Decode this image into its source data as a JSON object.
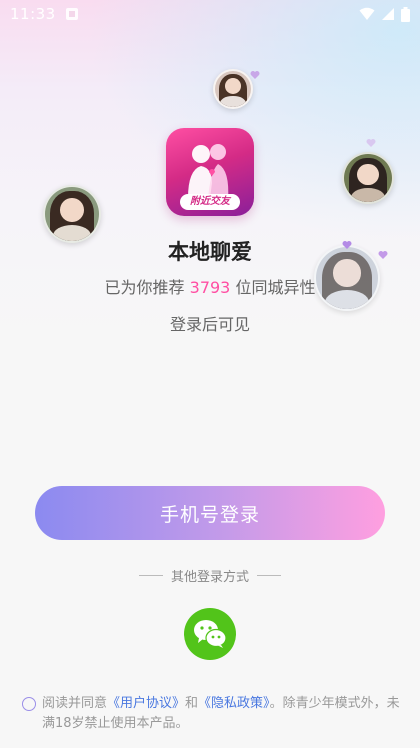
{
  "status_bar": {
    "time": "11:33",
    "icons": [
      "notification-icon",
      "wifi-icon",
      "signal-icon",
      "battery-icon"
    ]
  },
  "app": {
    "logo_badge": "附近交友",
    "title": "本地聊爱",
    "subtitle_prefix": "已为你推荐 ",
    "recommend_count": "3793",
    "subtitle_suffix": " 位同城异性",
    "hint": "登录后可见"
  },
  "login": {
    "phone_button_label": "手机号登录",
    "other_methods_label": "其他登录方式",
    "wechat_icon": "wechat-icon"
  },
  "agreement": {
    "prefix": "阅读并同意",
    "user_agreement": "《用户协议》",
    "and": "和",
    "privacy_policy": "《隐私政策》",
    "suffix": "。除青少年模式外，未满18岁禁止使用本产品。"
  },
  "colors": {
    "accent_pink": "#ff4fa3",
    "button_gradient_start": "#8b8af0",
    "button_gradient_end": "#ff9fe0",
    "wechat_green": "#52c41a",
    "link_blue": "#4a78e0"
  }
}
